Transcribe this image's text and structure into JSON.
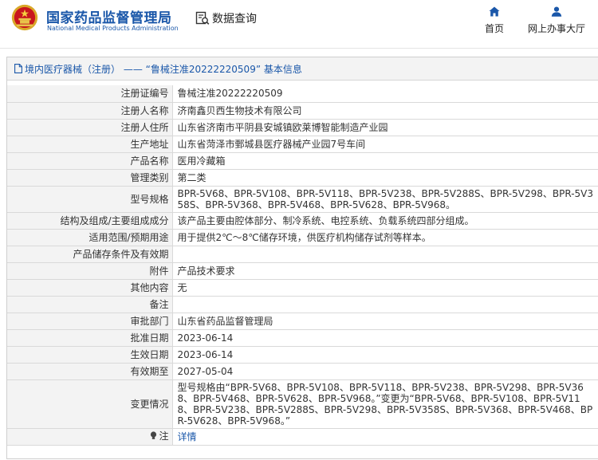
{
  "header": {
    "logo_cn": "国家药品监督管理局",
    "logo_en": "National Medical Products Administration",
    "search_label": "数据查询",
    "nav": [
      {
        "label": "首页",
        "icon": "home-icon"
      },
      {
        "label": "网上办事大厅",
        "icon": "user-icon"
      }
    ],
    "brand_color": "#1a57a9"
  },
  "panel": {
    "title": "境内医疗器械（注册） —— “鲁械注准20222220509” 基本信息",
    "rows": [
      {
        "label": "注册证编号",
        "value": "鲁械注准20222220509"
      },
      {
        "label": "注册人名称",
        "value": "济南鑫贝西生物技术有限公司"
      },
      {
        "label": "注册人住所",
        "value": "山东省济南市平阴县安城镇欧莱博智能制造产业园"
      },
      {
        "label": "生产地址",
        "value": "山东省菏泽市鄄城县医疗器械产业园7号车间"
      },
      {
        "label": "产品名称",
        "value": "医用冷藏箱"
      },
      {
        "label": "管理类别",
        "value": "第二类"
      },
      {
        "label": "型号规格",
        "value": "BPR-5V68、BPR-5V108、BPR-5V118、BPR-5V238、BPR-5V288S、BPR-5V298、BPR-5V358S、BPR-5V368、BPR-5V468、BPR-5V628、BPR-5V968。"
      },
      {
        "label": "结构及组成/主要组成成分",
        "value": "该产品主要由腔体部分、制冷系统、电控系统、负载系统四部分组成。"
      },
      {
        "label": "适用范围/预期用途",
        "value": "用于提供2℃～8℃储存环境，供医疗机构储存试剂等样本。"
      },
      {
        "label": "产品储存条件及有效期",
        "value": ""
      },
      {
        "label": "附件",
        "value": "产品技术要求"
      },
      {
        "label": "其他内容",
        "value": "无"
      },
      {
        "label": "备注",
        "value": ""
      },
      {
        "label": "审批部门",
        "value": "山东省药品监督管理局"
      },
      {
        "label": "批准日期",
        "value": "2023-06-14"
      },
      {
        "label": "生效日期",
        "value": "2023-06-14"
      },
      {
        "label": "有效期至",
        "value": "2027-05-04"
      },
      {
        "label": "变更情况",
        "value": "型号规格由“BPR-5V68、BPR-5V108、BPR-5V118、BPR-5V238、BPR-5V298、BPR-5V368、BPR-5V468、BPR-5V628、BPR-5V968。”变更为“BPR-5V68、BPR-5V108、BPR-5V118、BPR-5V238、BPR-5V288S、BPR-5V298、BPR-5V358S、BPR-5V368、BPR-5V468、BPR-5V628、BPR-5V968。”"
      }
    ],
    "note": {
      "label": "注",
      "link": "详情"
    }
  }
}
